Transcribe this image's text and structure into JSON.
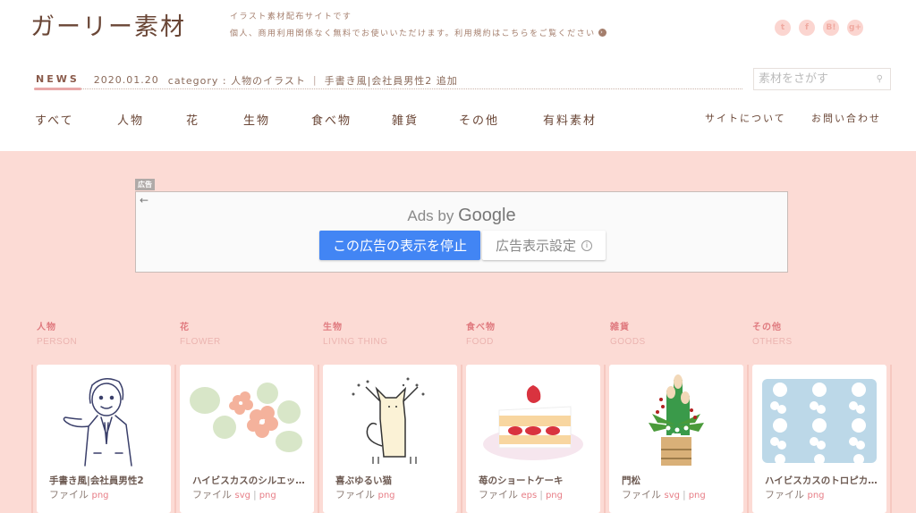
{
  "header": {
    "logo": "ガーリー素材",
    "tagline": "イラスト素材配布サイトです",
    "terms_text": "個人、商用利用関係なく無料でお使いいただけます。利用規約はこちらをご覧ください",
    "social": [
      {
        "name": "twitter-icon",
        "glyph": "t"
      },
      {
        "name": "facebook-icon",
        "glyph": "f"
      },
      {
        "name": "hatena-bookmark-icon",
        "glyph": "B!"
      },
      {
        "name": "google-plus-icon",
        "glyph": "g+"
      }
    ]
  },
  "news": {
    "label": "NEWS",
    "date": "2020.01.20",
    "category": "category : 人物のイラスト",
    "separator": "|",
    "item": "手書き風|会社員男性2 追加"
  },
  "search": {
    "placeholder": "素材をさがす",
    "value": ""
  },
  "nav": {
    "items": [
      "すべて",
      "人物",
      "花",
      "生物",
      "食べ物",
      "雑貨",
      "その他",
      "有料素材"
    ],
    "secondary": [
      "サイトについて",
      "お問い合わせ"
    ]
  },
  "ad": {
    "label": "広告",
    "ads_by": "Ads by",
    "google": "Google",
    "stop_button": "この広告の表示を停止",
    "settings_button": "広告表示設定"
  },
  "categories": [
    {
      "jp": "人物",
      "en": "PERSON"
    },
    {
      "jp": "花",
      "en": "FLOWER"
    },
    {
      "jp": "生物",
      "en": "LIVING THING"
    },
    {
      "jp": "食べ物",
      "en": "FOOD"
    },
    {
      "jp": "雑貨",
      "en": "GOODS"
    },
    {
      "jp": "その他",
      "en": "OTHERS"
    }
  ],
  "cards": [
    {
      "title": "手書き風|会社員男性2",
      "file_label": "ファイル",
      "types": [
        "png"
      ]
    },
    {
      "title": "ハイビスカスのシルエッ…",
      "file_label": "ファイル",
      "types": [
        "svg",
        "png"
      ]
    },
    {
      "title": "喜ぶゆるい猫",
      "file_label": "ファイル",
      "types": [
        "png"
      ]
    },
    {
      "title": "苺のショートケーキ",
      "file_label": "ファイル",
      "types": [
        "eps",
        "png"
      ]
    },
    {
      "title": "門松",
      "file_label": "ファイル",
      "types": [
        "svg",
        "png"
      ]
    },
    {
      "title": "ハイビスカスのトロピカ…",
      "file_label": "ファイル",
      "types": [
        "png"
      ]
    }
  ]
}
